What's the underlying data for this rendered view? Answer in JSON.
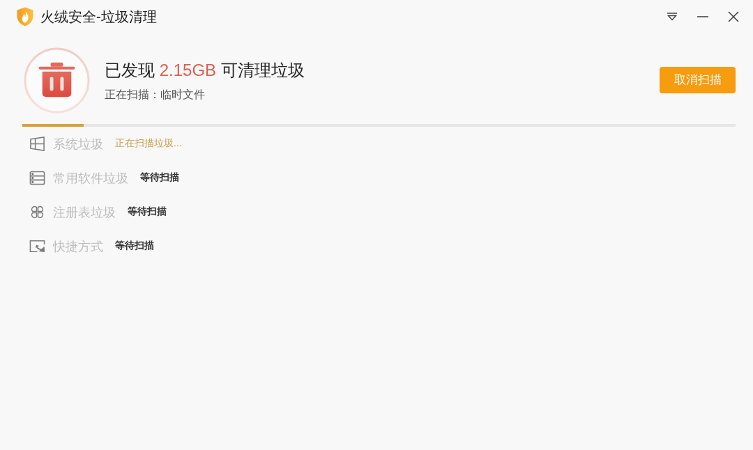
{
  "window": {
    "title": "火绒安全-垃圾清理"
  },
  "scan": {
    "headline": {
      "before": "已发现",
      "size": "2.15GB",
      "after": "可清理垃圾"
    },
    "status": "正在扫描：临时文件",
    "button": "取消扫描",
    "progress": {
      "level": 0.086
    }
  },
  "categories": [
    {
      "label": "系统垃圾",
      "status": {
        "kind": "scanning",
        "text": "正在扫描垃圾..."
      }
    },
    {
      "label": "常用软件垃圾",
      "status": {
        "kind": "waiting",
        "text": "等待扫描"
      }
    },
    {
      "label": "注册表垃圾",
      "status": {
        "kind": "waiting",
        "text": "等待扫描"
      }
    },
    {
      "label": "快捷方式",
      "status": {
        "kind": "waiting",
        "text": "等待扫描"
      }
    }
  ]
}
